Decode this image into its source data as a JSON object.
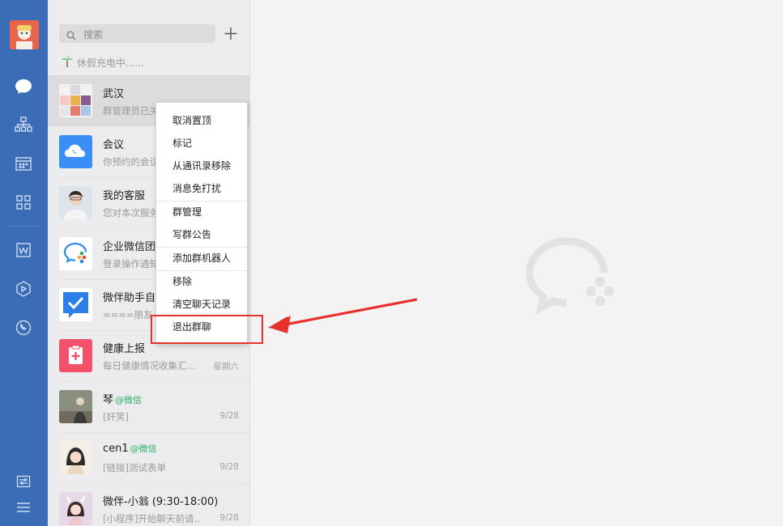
{
  "search": {
    "placeholder": "搜索"
  },
  "status_text": "休假充电中......",
  "conversations": [
    {
      "name": "武汉",
      "tag": "",
      "preview": "群管理员已关",
      "time": ""
    },
    {
      "name": "会议",
      "tag": "",
      "preview": "你预约的会议",
      "time": ""
    },
    {
      "name": "我的客服",
      "tag": "",
      "preview": "您对本次服务",
      "time": ""
    },
    {
      "name": "企业微信团",
      "tag": "",
      "preview": "登录操作通知",
      "time": ""
    },
    {
      "name": "微伴助手自",
      "tag": "",
      "preview": "====朋友",
      "time": ""
    },
    {
      "name": "健康上报",
      "tag": "",
      "preview": "每日健康情况收集汇...",
      "time": "星期六"
    },
    {
      "name": "琴",
      "tag": "@微信",
      "preview": "[奸笑]",
      "time": "9/28"
    },
    {
      "name": "cen1",
      "tag": "@微信",
      "preview": "[链接]测试表单",
      "time": "9/28"
    },
    {
      "name": "微伴-小翁 (9:30-18:00)",
      "tag": "",
      "preview": "[小程序]开始聊天前请...",
      "time": "9/28"
    }
  ],
  "context_menu": [
    "取消置顶",
    "标记",
    "从通讯录移除",
    "消息免打扰",
    "群管理",
    "写群公告",
    "添加群机器人",
    "移除",
    "清空聊天记录",
    "退出群聊"
  ],
  "colors": {
    "sidebar": "#3b6cb6",
    "list_bg": "#ececee",
    "main_bg": "#f3f3f4",
    "highlight": "#e8312d",
    "tag_green": "#2aae67"
  },
  "icons": [
    "user-avatar-icon",
    "chat-icon",
    "org-chart-icon",
    "calendar-icon",
    "apps-grid-icon",
    "doc-w-icon",
    "video-play-icon",
    "cloud-phone-icon",
    "settings-icon",
    "menu-icon",
    "search-icon",
    "plus-icon",
    "palm-tree-icon"
  ]
}
